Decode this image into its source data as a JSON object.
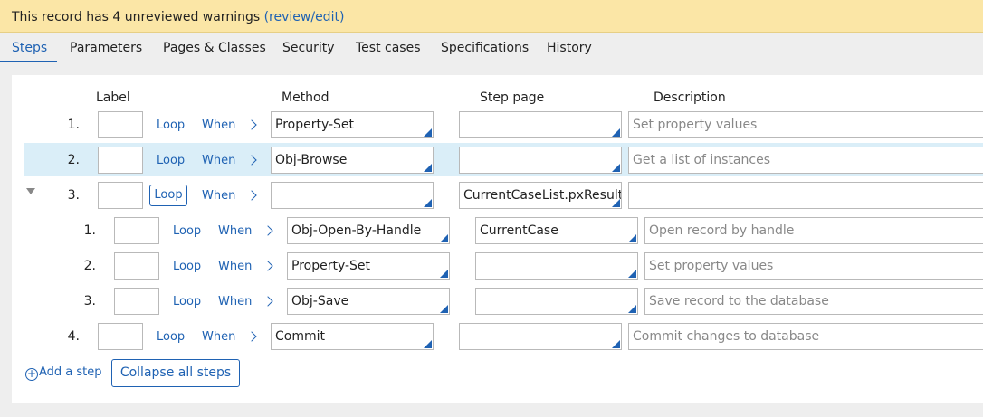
{
  "warning": {
    "text": "This record has 4 unreviewed warnings ",
    "link": "(review/edit)"
  },
  "tabs": [
    "Steps",
    "Parameters",
    "Pages & Classes",
    "Security",
    "Test cases",
    "Specifications",
    "History"
  ],
  "columns": {
    "label": "Label",
    "method": "Method",
    "step_page": "Step page",
    "description": "Description"
  },
  "loop_label": "Loop",
  "when_label": "When",
  "steps": [
    {
      "num": "1.",
      "method": "Property-Set",
      "step_page": "",
      "description": "Set property values"
    },
    {
      "num": "2.",
      "method": "Obj-Browse",
      "step_page": "",
      "description": "Get a list of instances"
    },
    {
      "num": "3.",
      "method": "",
      "step_page": "CurrentCaseList.pxResults",
      "description": ""
    },
    {
      "num": "1.",
      "method": "Obj-Open-By-Handle",
      "step_page": "CurrentCase",
      "description": "Open record by handle"
    },
    {
      "num": "2.",
      "method": "Property-Set",
      "step_page": "",
      "description": "Set property values"
    },
    {
      "num": "3.",
      "method": "Obj-Save",
      "step_page": "",
      "description": "Save record to the database"
    },
    {
      "num": "4.",
      "method": "Commit",
      "step_page": "",
      "description": "Commit changes to database"
    }
  ],
  "actions": {
    "add_step": "Add a step",
    "collapse_all": "Collapse all steps"
  },
  "colors": {
    "accent": "#1f62b3",
    "warning_bg": "#fbe6a6",
    "row_highlight": "#daeef8"
  }
}
